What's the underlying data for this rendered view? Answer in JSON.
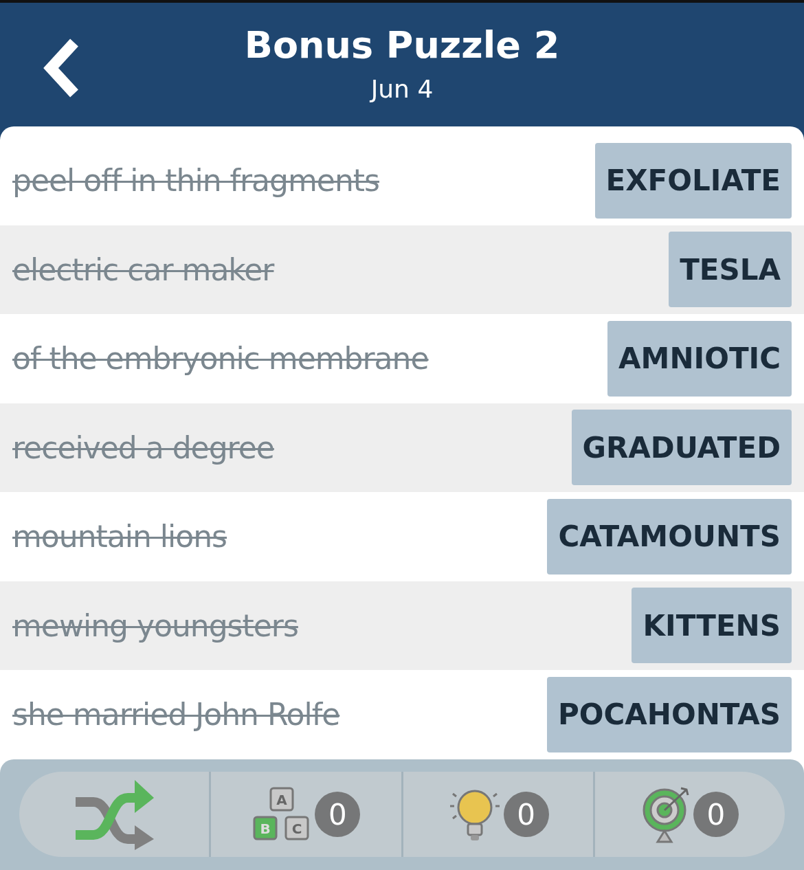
{
  "header": {
    "title": "Bonus Puzzle 2",
    "subtitle": "Jun 4"
  },
  "clues": [
    {
      "clue": "peel off in thin fragments",
      "answer": "EXFOLIATE",
      "solved": true
    },
    {
      "clue": "electric car maker",
      "answer": "TESLA",
      "solved": true
    },
    {
      "clue": "of the embryonic membrane",
      "answer": "AMNIOTIC",
      "solved": true
    },
    {
      "clue": "received a degree",
      "answer": "GRADUATED",
      "solved": true
    },
    {
      "clue": "mountain lions",
      "answer": "CATAMOUNTS",
      "solved": true
    },
    {
      "clue": "mewing youngsters",
      "answer": "KITTENS",
      "solved": true
    },
    {
      "clue": "she married John Rolfe",
      "answer": "POCAHONTAS",
      "solved": true
    }
  ],
  "tools": [
    {
      "kind": "shuffle"
    },
    {
      "kind": "letters",
      "letters": [
        "A",
        "B",
        "C"
      ],
      "count": "0"
    },
    {
      "kind": "hint",
      "count": "0"
    },
    {
      "kind": "target",
      "count": "0"
    }
  ]
}
